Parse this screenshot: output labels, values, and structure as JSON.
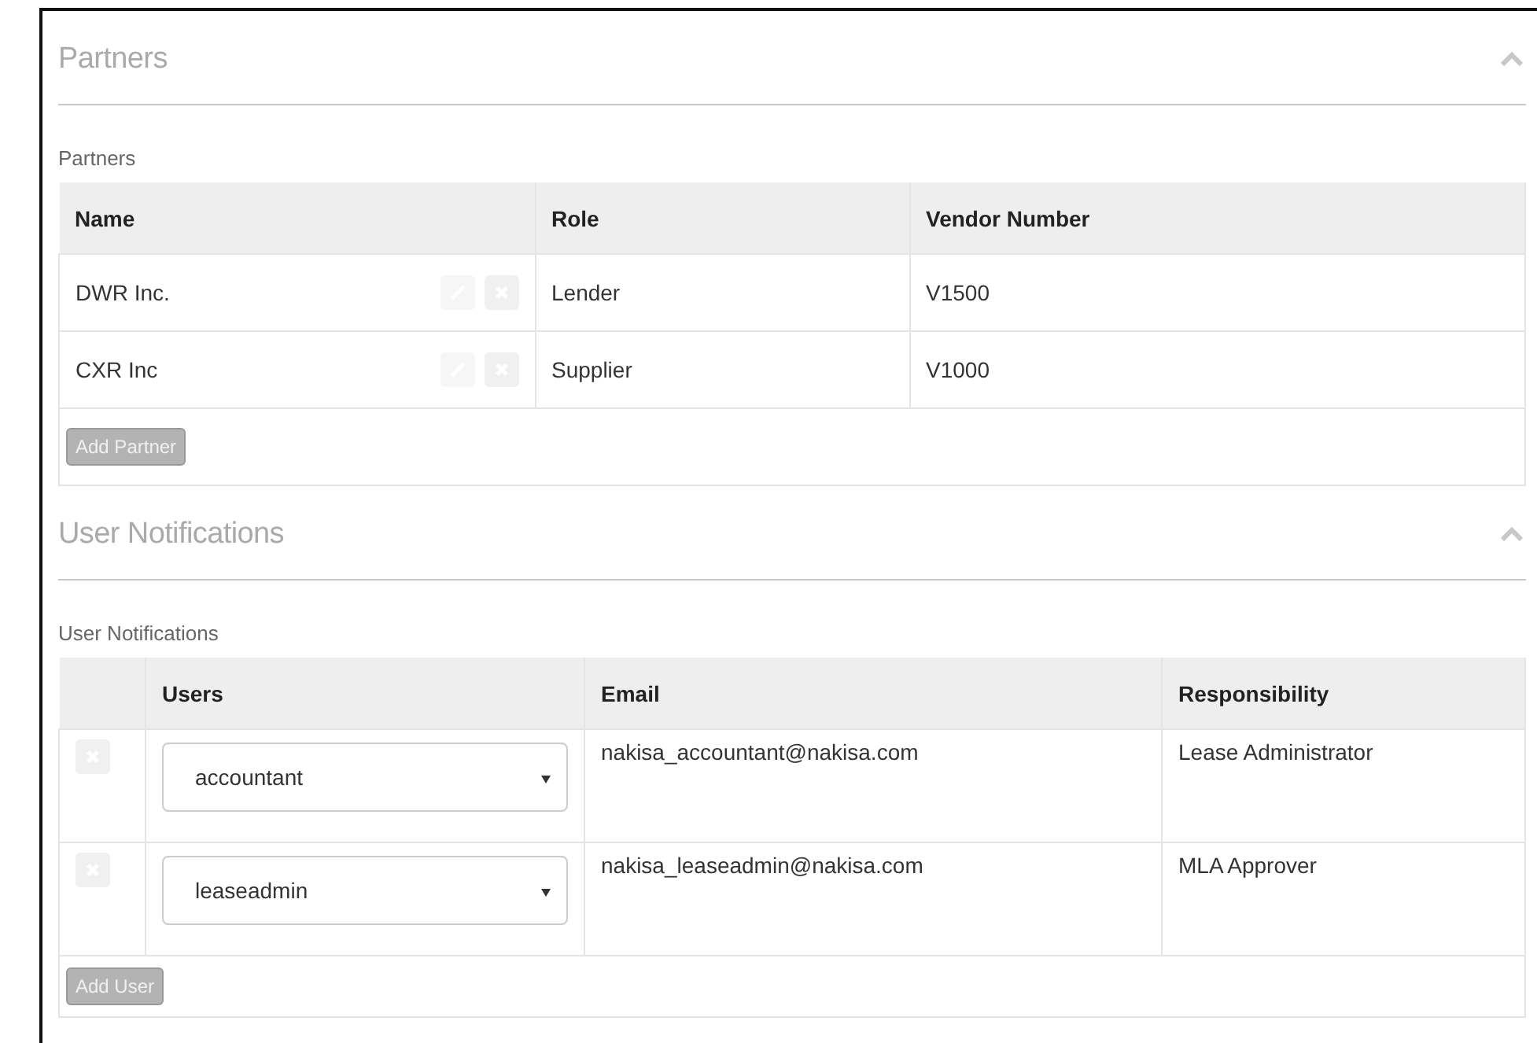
{
  "partners": {
    "title": "Partners",
    "subtitle": "Partners",
    "columns": [
      "Name",
      "Role",
      "Vendor Number"
    ],
    "rows": [
      {
        "name": "DWR Inc.",
        "role": "Lender",
        "vendor_number": "V1500"
      },
      {
        "name": "CXR Inc",
        "role": "Supplier",
        "vendor_number": "V1000"
      }
    ],
    "add_button": {
      "label": "Add Partner",
      "disabled": true
    }
  },
  "user_notifications": {
    "title": "User Notifications",
    "subtitle": "User Notifications",
    "columns": [
      "Users",
      "Email",
      "Responsibility"
    ],
    "rows": [
      {
        "user": "accountant",
        "email": "nakisa_accountant@nakisa.com",
        "responsibility": "Lease Administrator"
      },
      {
        "user": "leaseadmin",
        "email": "nakisa_leaseadmin@nakisa.com",
        "responsibility": "MLA Approver"
      }
    ],
    "add_button": {
      "label": "Add User",
      "disabled": true
    }
  }
}
